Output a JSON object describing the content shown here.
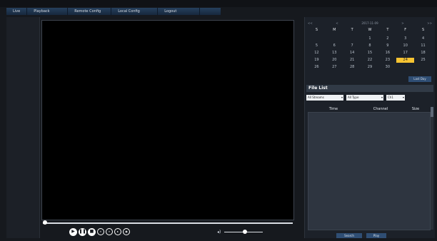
{
  "menu": {
    "items": [
      "Live",
      "Playback",
      "Remote Config",
      "Local Config",
      "Logout"
    ]
  },
  "calendar": {
    "header": [
      "<<",
      "<",
      "2017-11-09",
      ">",
      ">>"
    ],
    "weekdays": [
      "S",
      "M",
      "T",
      "W",
      "T",
      "F",
      "S"
    ],
    "days": [
      "",
      "",
      "",
      "1",
      "2",
      "3",
      "4",
      "5",
      "6",
      "7",
      "8",
      "9",
      "10",
      "11",
      "12",
      "13",
      "14",
      "15",
      "16",
      "17",
      "18",
      "19",
      "20",
      "21",
      "22",
      "23",
      "24",
      "25",
      "26",
      "27",
      "28",
      "29",
      "30",
      "",
      ""
    ],
    "selected_day": "24",
    "button": "Last Day"
  },
  "file_list": {
    "title": "File List",
    "filters": {
      "stream": "All Streams",
      "type": "All Type",
      "channel": "Ch1"
    },
    "columns": [
      "Time",
      "Channel",
      "Size"
    ]
  },
  "bottom": {
    "search": "Search",
    "play": "Play"
  }
}
